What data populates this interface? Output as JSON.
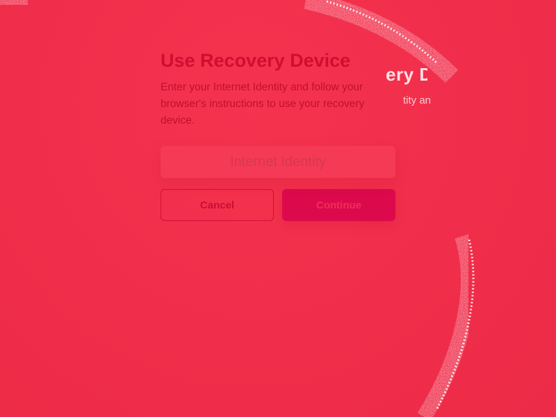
{
  "dialog": {
    "title": "Use Recovery Device",
    "description": "Enter your Internet Identity and follow your browser's instructions to use your recovery device.",
    "input_placeholder": "Internet Identity",
    "input_value": "",
    "cancel_label": "Cancel",
    "continue_label": "Continue"
  },
  "background": {
    "ghost_title": "ery D",
    "ghost_subtitle": "tity an"
  },
  "colors": {
    "background": "#f22f4c",
    "title": "#cf0f30",
    "continue_button": "#dc0a4d"
  }
}
